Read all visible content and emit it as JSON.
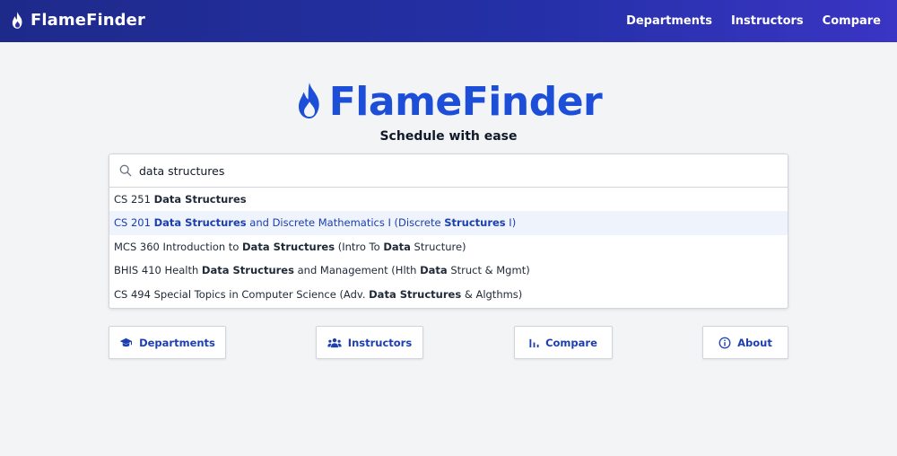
{
  "header": {
    "brand": "FlameFinder",
    "nav": [
      "Departments",
      "Instructors",
      "Compare"
    ]
  },
  "hero": {
    "title": "FlameFinder",
    "tagline": "Schedule with ease"
  },
  "search": {
    "value": "data structures",
    "suggestions": [
      [
        {
          "t": "CS 251 ",
          "b": false
        },
        {
          "t": "Data Structures",
          "b": true
        }
      ],
      [
        {
          "t": "CS 201 ",
          "b": false
        },
        {
          "t": "Data Structures",
          "b": true
        },
        {
          "t": " and Discrete Mathematics I (Discrete ",
          "b": false
        },
        {
          "t": "Structures",
          "b": true
        },
        {
          "t": " I)",
          "b": false
        }
      ],
      [
        {
          "t": "MCS 360 Introduction to ",
          "b": false
        },
        {
          "t": "Data Structures",
          "b": true
        },
        {
          "t": " (Intro To ",
          "b": false
        },
        {
          "t": "Data",
          "b": true
        },
        {
          "t": " Structure)",
          "b": false
        }
      ],
      [
        {
          "t": "BHIS 410 Health ",
          "b": false
        },
        {
          "t": "Data Structures",
          "b": true
        },
        {
          "t": " and Management (Hlth ",
          "b": false
        },
        {
          "t": "Data",
          "b": true
        },
        {
          "t": " Struct & Mgmt)",
          "b": false
        }
      ],
      [
        {
          "t": "CS 494 Special Topics in Computer Science (Adv. ",
          "b": false
        },
        {
          "t": "Data Structures",
          "b": true
        },
        {
          "t": " & Algthms)",
          "b": false
        }
      ]
    ],
    "active_index": 1
  },
  "quick_links": [
    {
      "label": "Departments",
      "icon": "graduation-cap-icon"
    },
    {
      "label": "Instructors",
      "icon": "users-icon"
    },
    {
      "label": "Compare",
      "icon": "bar-chart-icon"
    },
    {
      "label": "About",
      "icon": "info-icon"
    }
  ],
  "colors": {
    "accent": "#1d4ed8",
    "header_start": "#1e2a8a",
    "header_end": "#3a35c4",
    "active_row": "#eef3fc"
  }
}
